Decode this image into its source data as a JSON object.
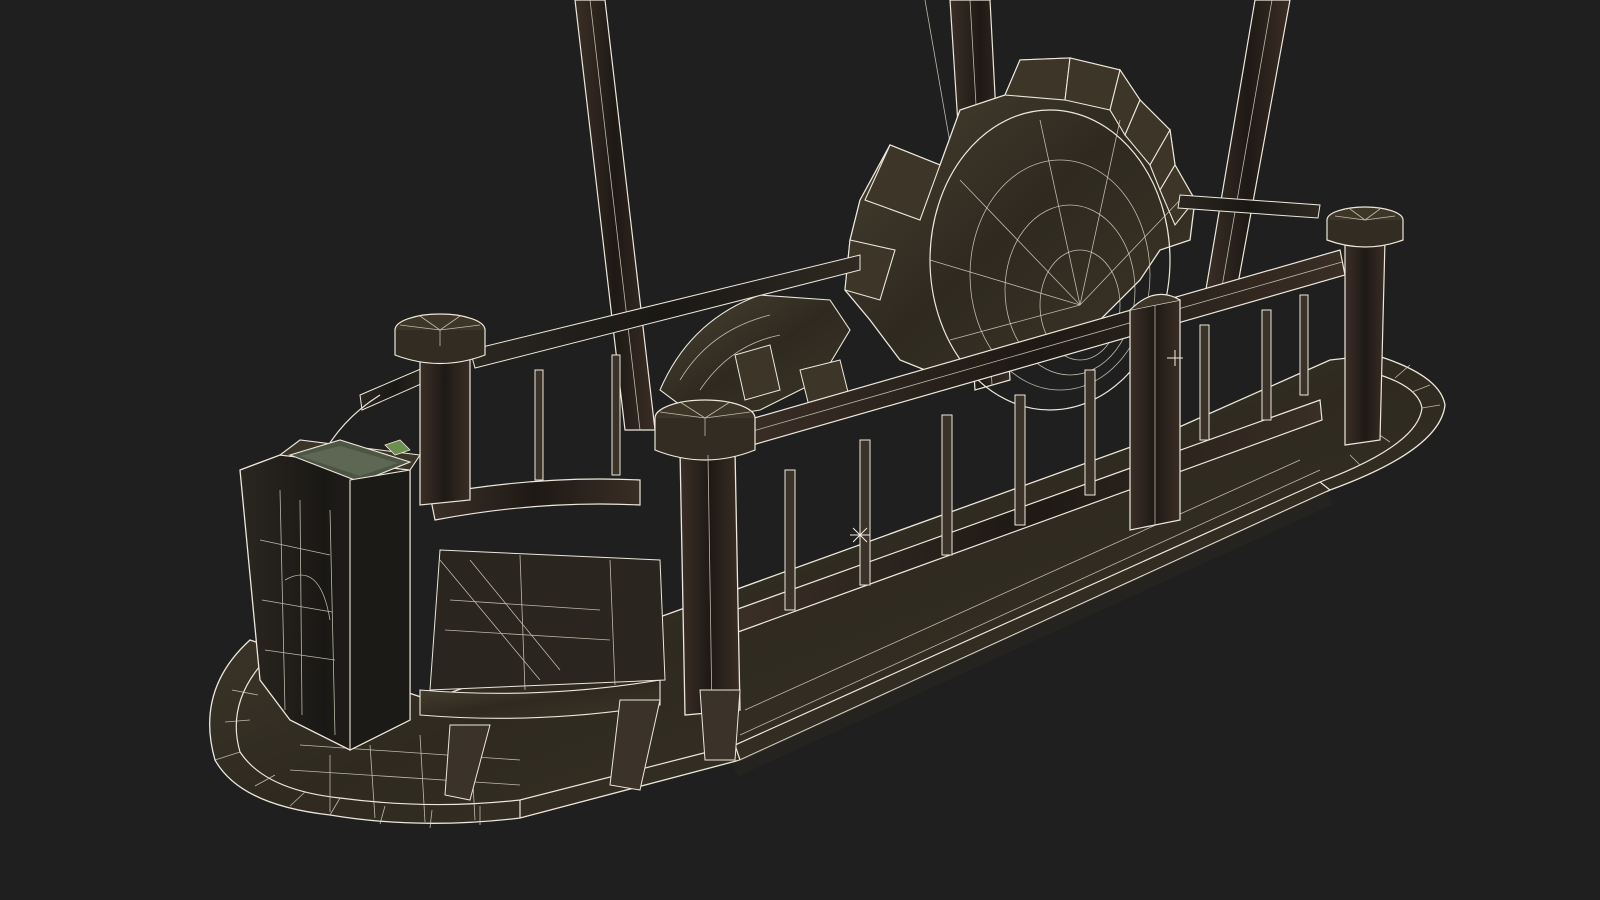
{
  "viewport": {
    "background": "#1f1f1f",
    "render_mode": "wireframe-over-shaded",
    "wire_color": "#e9e4d6",
    "surface_color": "#3a3428"
  },
  "model": {
    "subject": "paddle-steamer-boat",
    "parts": [
      "hull-deck",
      "railing",
      "corner-post-front-left",
      "corner-post-front-mid",
      "corner-post-mid",
      "corner-post-rear-right",
      "paddle-wheel",
      "rear-wheel",
      "control-cabinet",
      "smokestack-left",
      "smokestack-center",
      "smokestack-right",
      "balusters"
    ]
  }
}
